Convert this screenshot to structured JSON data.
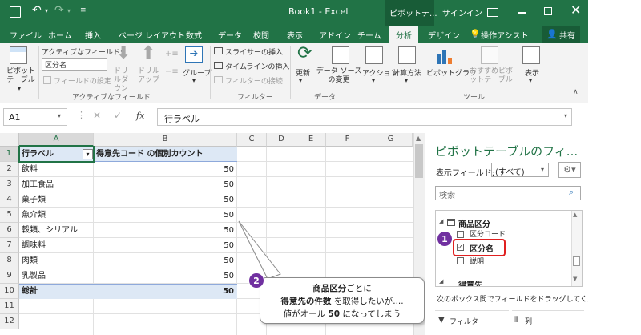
{
  "titlebar": {
    "title": "Book1 - Excel",
    "context_tab": "ピボットテ...",
    "signin": "サインイン"
  },
  "tabs": [
    "ファイル",
    "ホーム",
    "挿入",
    "ページ レイアウト",
    "数式",
    "データ",
    "校閲",
    "表示",
    "アドイン",
    "チーム",
    "分析",
    "デザイン",
    "操作アシスト",
    "共有"
  ],
  "ribbon": {
    "pivot_table": "ピボットテーブル",
    "active_field_label": "アクティブなフィールド:",
    "active_field_value": "区分名",
    "field_settings": "フィールドの設定",
    "drilldown": "ドリルダウン",
    "drillup": "ドリルアップ",
    "group_active_field": "アクティブなフィールド",
    "group_btn": "グループ",
    "slicer": "スライサーの挿入",
    "timeline": "タイムラインの挿入",
    "filter_conn": "フィルターの接続",
    "group_filter": "フィルター",
    "refresh": "更新",
    "change_source": "データ ソースの変更",
    "group_data": "データ",
    "action": "アクション",
    "calc": "計算方法",
    "pivot_chart": "ピボットグラフ",
    "recommended": "おすすめピボットテーブル",
    "group_tools": "ツール",
    "show": "表示"
  },
  "formula_bar": {
    "name_box": "A1",
    "fx": "fx",
    "content": "行ラベル"
  },
  "grid": {
    "columns": [
      "A",
      "B",
      "C",
      "D",
      "E",
      "F",
      "G"
    ],
    "header_a": "行ラベル",
    "header_b": "得意先コード の個別カウント",
    "rows": [
      {
        "label": "飲料",
        "value": "50"
      },
      {
        "label": "加工食品",
        "value": "50"
      },
      {
        "label": "菓子類",
        "value": "50"
      },
      {
        "label": "魚介類",
        "value": "50"
      },
      {
        "label": "穀類、シリアル",
        "value": "50"
      },
      {
        "label": "調味料",
        "value": "50"
      },
      {
        "label": "肉類",
        "value": "50"
      },
      {
        "label": "乳製品",
        "value": "50"
      }
    ],
    "total_label": "総計",
    "total_value": "50",
    "row_numbers": [
      "1",
      "2",
      "3",
      "4",
      "5",
      "6",
      "7",
      "8",
      "9",
      "10",
      "11",
      "12"
    ]
  },
  "pane": {
    "title": "ピボットテーブルのフィ...",
    "show_fields_label": "表示フィールド:",
    "show_fields_value": "(すべて)",
    "search_placeholder": "検索",
    "table_name": "商品区分",
    "fields": [
      {
        "label": "区分コード",
        "checked": false
      },
      {
        "label": "区分名",
        "checked": true
      },
      {
        "label": "説明",
        "checked": false
      }
    ],
    "next_table": "得意先",
    "drag_hint": "次のボックス間でフィールドをドラッグしてください:",
    "filter_area": "フィルター",
    "columns_area": "列"
  },
  "callouts": {
    "one": "1",
    "two": "2",
    "note_line1_bold": "商品区分",
    "note_line1_rest": "ごとに",
    "note_line2_bold": "得意先の件数",
    "note_line2_rest": " を取得したいが....",
    "note_line3_pre": "値がオール ",
    "note_line3_bold": "50",
    "note_line3_post": " になってしまう"
  },
  "colors": {
    "excel_green": "#217346",
    "callout_purple": "#7030a0",
    "highlight_red": "#e02020",
    "header_blue": "#dde8f5"
  }
}
